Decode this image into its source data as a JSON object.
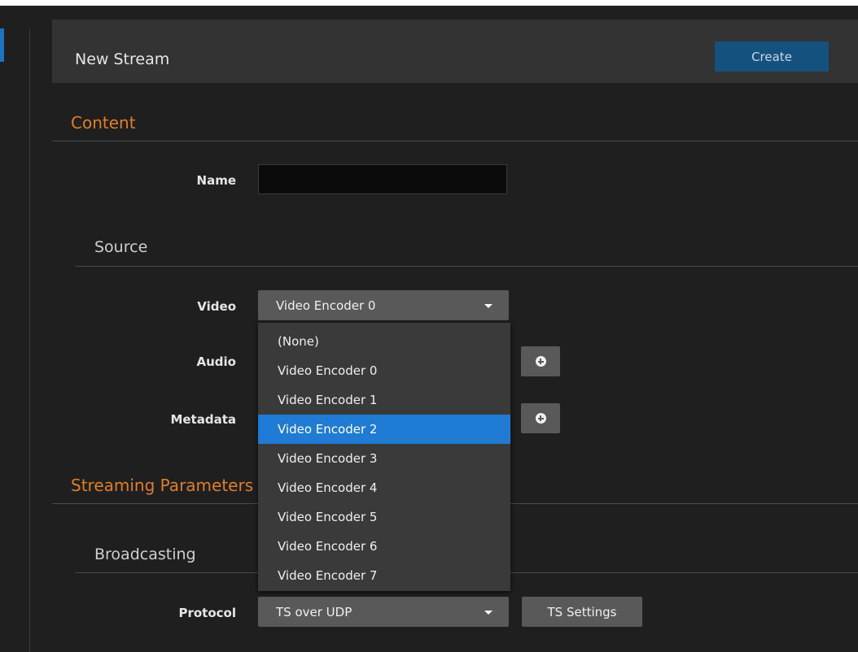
{
  "header": {
    "title": "New Stream",
    "create_label": "Create"
  },
  "content": {
    "section_title": "Content",
    "name_label": "Name",
    "name_value": "",
    "source_title": "Source",
    "video_label": "Video",
    "video_value": "Video Encoder 0",
    "audio_label": "Audio",
    "metadata_label": "Metadata"
  },
  "dropdown": {
    "items": [
      {
        "label": "(None)",
        "selected": false
      },
      {
        "label": "Video Encoder 0",
        "selected": false
      },
      {
        "label": "Video Encoder 1",
        "selected": false
      },
      {
        "label": "Video Encoder 2",
        "selected": true
      },
      {
        "label": "Video Encoder 3",
        "selected": false
      },
      {
        "label": "Video Encoder 4",
        "selected": false
      },
      {
        "label": "Video Encoder 5",
        "selected": false
      },
      {
        "label": "Video Encoder 6",
        "selected": false
      },
      {
        "label": "Video Encoder 7",
        "selected": false
      }
    ]
  },
  "streaming": {
    "section_title": "Streaming Parameters",
    "broadcasting_title": "Broadcasting",
    "protocol_label": "Protocol",
    "protocol_value": "TS over UDP",
    "ts_settings_label": "TS Settings"
  },
  "colors": {
    "accent": "#e07f23",
    "primary": "#14517e",
    "highlight": "#1f7bd3"
  }
}
